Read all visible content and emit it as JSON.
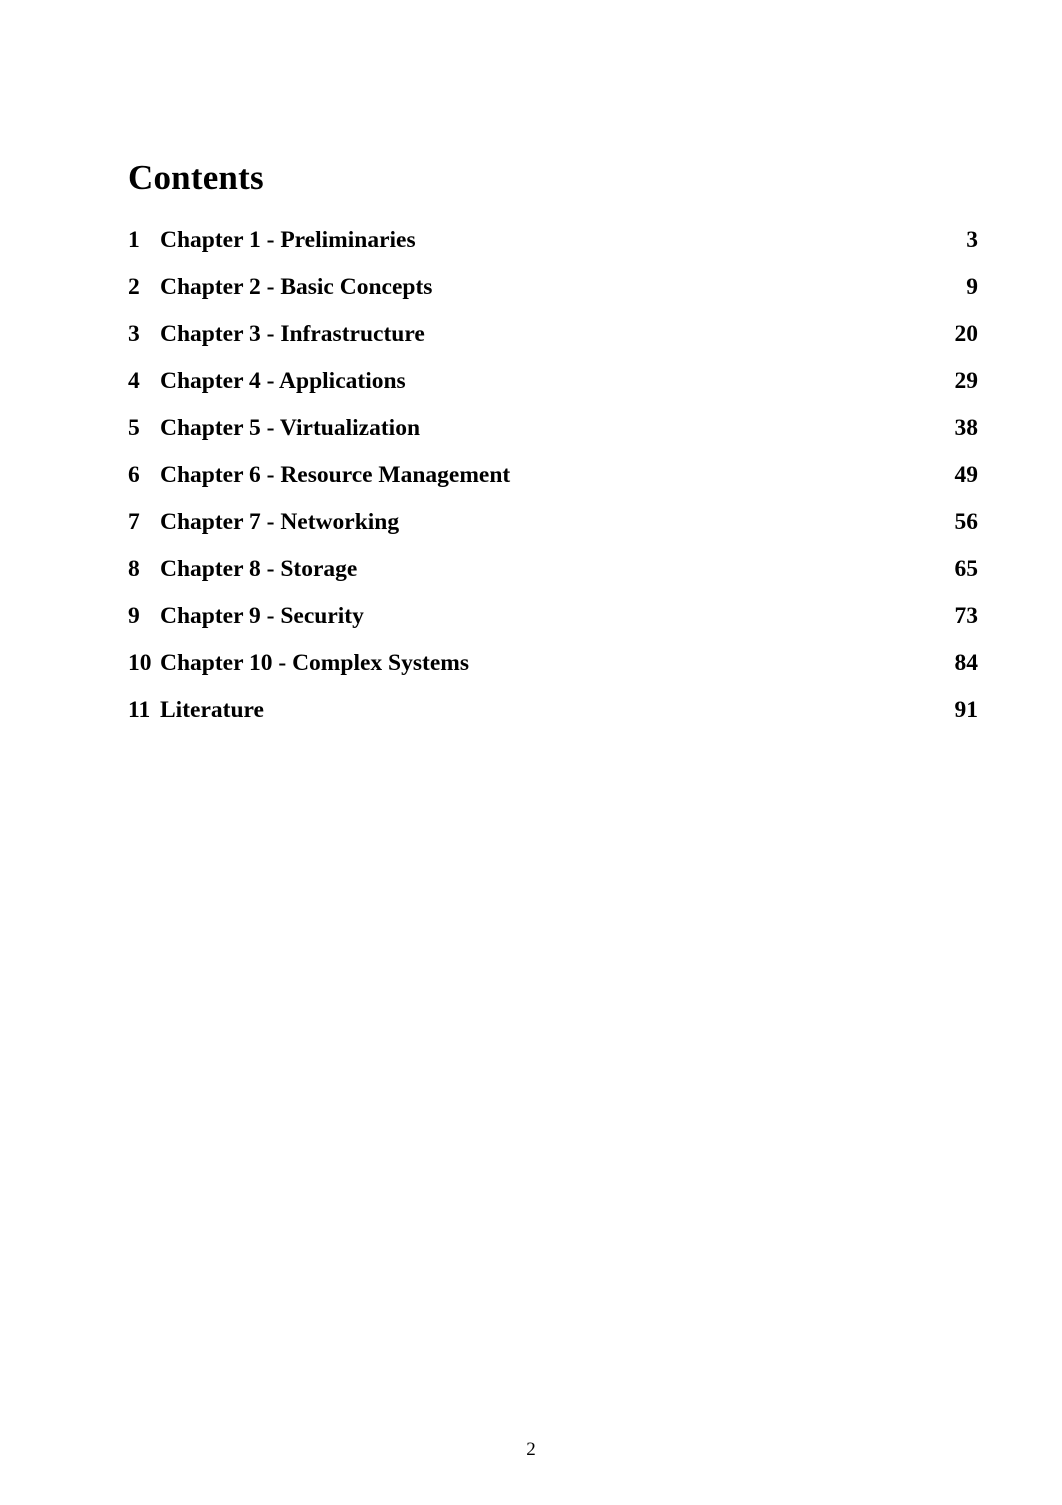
{
  "document": {
    "heading": "Contents",
    "footer_page_number": "2",
    "text_color": "#000000",
    "background_color": "#ffffff"
  },
  "toc": {
    "entries": [
      {
        "number": "1",
        "title": "Chapter 1 - Preliminaries",
        "page": "3"
      },
      {
        "number": "2",
        "title": "Chapter 2 - Basic Concepts",
        "page": "9"
      },
      {
        "number": "3",
        "title": "Chapter 3 - Infrastructure",
        "page": "20"
      },
      {
        "number": "4",
        "title": "Chapter 4 - Applications",
        "page": "29"
      },
      {
        "number": "5",
        "title": "Chapter 5 - Virtualization",
        "page": "38"
      },
      {
        "number": "6",
        "title": "Chapter 6 - Resource Management",
        "page": "49"
      },
      {
        "number": "7",
        "title": "Chapter 7 - Networking",
        "page": "56"
      },
      {
        "number": "8",
        "title": "Chapter 8 - Storage",
        "page": "65"
      },
      {
        "number": "9",
        "title": "Chapter 9 - Security",
        "page": "73"
      },
      {
        "number": "10",
        "title": "Chapter 10 - Complex Systems",
        "page": "84"
      },
      {
        "number": "11",
        "title": "Literature",
        "page": "91"
      }
    ]
  }
}
